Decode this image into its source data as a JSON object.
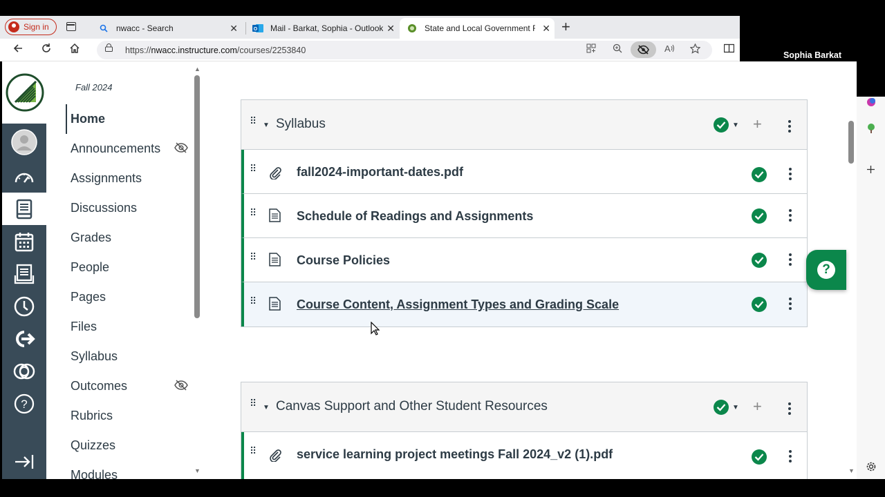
{
  "browser": {
    "signin_label": "Sign in",
    "tabs": [
      {
        "title": "nwacc - Search",
        "icon": "search-icon"
      },
      {
        "title": "Mail - Barkat, Sophia - Outlook",
        "icon": "outlook-icon"
      },
      {
        "title": "State and Local Government Fall",
        "icon": "canvas-icon"
      }
    ],
    "url_prefix": "https://",
    "url_host": "nwacc.instructure.com",
    "url_path": "/courses/2253840"
  },
  "video": {
    "participant": "Sophia Barkat"
  },
  "course_nav": {
    "term": "Fall 2024",
    "items": [
      {
        "label": "Home",
        "active": true,
        "hidden": false
      },
      {
        "label": "Announcements",
        "hidden": true
      },
      {
        "label": "Assignments",
        "hidden": false
      },
      {
        "label": "Discussions",
        "hidden": false
      },
      {
        "label": "Grades",
        "hidden": false
      },
      {
        "label": "People",
        "hidden": false
      },
      {
        "label": "Pages",
        "hidden": false
      },
      {
        "label": "Files",
        "hidden": false
      },
      {
        "label": "Syllabus",
        "hidden": false
      },
      {
        "label": "Outcomes",
        "hidden": true
      },
      {
        "label": "Rubrics",
        "hidden": false
      },
      {
        "label": "Quizzes",
        "hidden": false
      },
      {
        "label": "Modules",
        "hidden": false
      }
    ]
  },
  "modules": [
    {
      "title": "Syllabus",
      "items": [
        {
          "type": "attachment",
          "title": "fall2024-important-dates.pdf"
        },
        {
          "type": "page",
          "title": "Schedule of Readings and Assignments"
        },
        {
          "type": "page",
          "title": "Course Policies"
        },
        {
          "type": "page",
          "title": "Course Content, Assignment Types and Grading Scale"
        }
      ]
    },
    {
      "title": "Canvas Support and Other Student Resources",
      "items": [
        {
          "type": "attachment",
          "title": "service learning project meetings Fall 2024_v2 (1).pdf"
        }
      ]
    }
  ],
  "help_glyph": "?",
  "colors": {
    "brand": "#394b58",
    "published": "#0b874b",
    "text": "#2d3b45"
  }
}
